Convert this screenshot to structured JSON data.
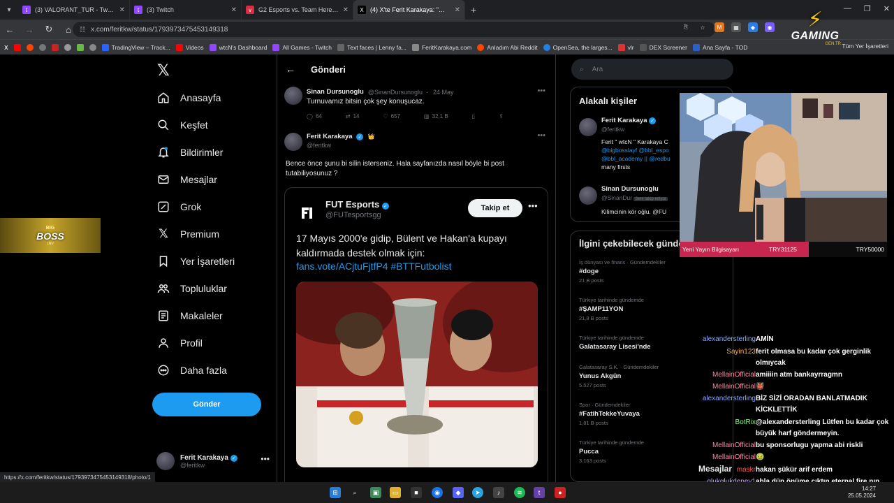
{
  "tabs": [
    {
      "label": "(3) VALORANT_TUR - Twitch",
      "color": "#9146ff"
    },
    {
      "label": "(3) Twitch",
      "color": "#9146ff"
    },
    {
      "label": "G2 Esports vs. Team Heretics | (",
      "color": "#d62d42"
    },
    {
      "label": "(4) X'te Ferit Karakaya: \"@Sinan",
      "color": "#444"
    }
  ],
  "url": "x.com/feritkw/status/1793973475453149318",
  "bookmarks": [
    {
      "label": "TradingView – Track...",
      "color": "#2962ff"
    },
    {
      "label": "Videos",
      "color": "#f00"
    },
    {
      "label": "wtcN's Dashboard",
      "color": "#9146ff"
    },
    {
      "label": "All Games - Twitch",
      "color": "#9146ff"
    },
    {
      "label": "Text faces | Lenny fa...",
      "color": "#666"
    },
    {
      "label": "FeritKarakaya.com",
      "color": "#888"
    },
    {
      "label": "Anladım Abi Reddit",
      "color": "#ff4500"
    },
    {
      "label": "OpenSea, the larges...",
      "color": "#2081e2"
    },
    {
      "label": "vlr",
      "color": "#d33"
    },
    {
      "label": "DEX Screener",
      "color": "#555"
    },
    {
      "label": "Ana Sayfa - TOD",
      "color": "#2a60c8"
    }
  ],
  "bookmarks_right": "Tüm Yer İşaretleri",
  "logo": {
    "brand": "GAMING",
    "sub": "GEN.TR"
  },
  "bigboss": {
    "line1": "BIG",
    "line2": "BOSS",
    "line3": "LNV"
  },
  "nav": [
    {
      "label": "Anasayfa",
      "icon": "home-icon"
    },
    {
      "label": "Keşfet",
      "icon": "search-icon"
    },
    {
      "label": "Bildirimler",
      "icon": "bell-icon"
    },
    {
      "label": "Mesajlar",
      "icon": "envelope-icon"
    },
    {
      "label": "Grok",
      "icon": "grok-icon"
    },
    {
      "label": "Premium",
      "icon": "x-icon"
    },
    {
      "label": "Yer İşaretleri",
      "icon": "bookmark-icon"
    },
    {
      "label": "Topluluklar",
      "icon": "people-icon"
    },
    {
      "label": "Makaleler",
      "icon": "article-icon"
    },
    {
      "label": "Profil",
      "icon": "person-icon"
    },
    {
      "label": "Daha fazla",
      "icon": "more-circle-icon"
    }
  ],
  "nav_post_button": "Gönder",
  "account": {
    "name": "Ferit Karakaya",
    "handle": "@feritkw"
  },
  "main": {
    "header": "Gönderi",
    "reply": {
      "name": "Sinan Dursunoglu",
      "handle": "@SinanDursunoglu",
      "date": "24 May",
      "text": "Turnuvamız bitsin çok şey konuşucaz.",
      "replies": "64",
      "retweets": "14",
      "likes": "657",
      "views": "32,1 B"
    },
    "post": {
      "name": "Ferit Karakaya",
      "handle": "@feritkw",
      "text": "Bence önce şunu bi silin isterseniz. Hala sayfanızda nasıl böyle bi post tutabiliyosunuz ?"
    },
    "quote": {
      "name": "FUT Esports",
      "handle": "@FUTesportsgg",
      "follow": "Takip et",
      "text": "17 Mayıs 2000'e gidip, Bülent ve Hakan'a kupayı kaldırmada destek olmak için:",
      "link": "fans.vote/ACjtuFjtfP4 #BTTFutbolist"
    }
  },
  "search_placeholder": "Ara",
  "related": {
    "title": "Alakalı kişiler",
    "people": [
      {
        "name": "Ferit Karakaya",
        "handle": "@feritkw"
      },
      {
        "name": "Sinan Dursunoglu",
        "handle": "@SinanDur",
        "badge": "Seni takip ediyor"
      }
    ],
    "bio1": [
      "Ferit \" wtcN \" Karakaya C",
      "@bigbosslayf @bbl_espo",
      "@bbl_academy || @redbu",
      "many firsts"
    ],
    "bio2": "Kilimcinin kör oğlu. @FU"
  },
  "trends": {
    "title": "İlgini çekebilecek gündem",
    "items": [
      {
        "ctx": "İş dünyası ve finans · Gündemdekiler",
        "name": "#doge",
        "count": "21 B posts"
      },
      {
        "ctx": "Türkiye tarihinde gündemde",
        "name": "#ŞAMP11YON",
        "count": "21,8 B posts"
      },
      {
        "ctx": "Türkiye tarihinde gündemde",
        "name": "Galatasaray Lisesi'nde",
        "count": ""
      },
      {
        "ctx": "Galatasaray S.K. · Gündemdekiler",
        "name": "Yunus Akgün",
        "count": "5.527 posts"
      },
      {
        "ctx": "Spor · Gündemdekiler",
        "name": "#FatihTekkeYuvaya",
        "count": "1,81 B posts"
      },
      {
        "ctx": "Türkiye tarihinde gündemde",
        "name": "Pucca",
        "count": "3.163 posts"
      }
    ]
  },
  "donation": {
    "label": "Yeni Yayın Bilgisayarı",
    "current": "TRY31125",
    "goal": "TRY50000",
    "progress": 0.6225
  },
  "chat": [
    {
      "user": "alexandersterling",
      "color": "#8aa8ff",
      "msg": "AMİN"
    },
    {
      "user": "Sayin123",
      "color": "#ffb24d",
      "msg": "ferit olmasa bu kadar çok gerginlik olmıycak"
    },
    {
      "user": "MellainOfficial",
      "color": "#ff8aa6",
      "msg": "amiiiin atm bankayrragmn"
    },
    {
      "user": "MellainOfficial",
      "color": "#ff8aa6",
      "msg": "👹"
    },
    {
      "user": "alexandersterling",
      "color": "#8aa8ff",
      "msg": "BİZ SİZİ ORADAN BANLATMADIK KİCKLETTİK"
    },
    {
      "user": "BotRix",
      "color": "#7dff7d",
      "msg": "@alexandersterling Lütfen bu kadar çok büyük harf göndermeyin."
    },
    {
      "user": "MellainOfficial",
      "color": "#ff8aa6",
      "msg": "bu sponsorlugu yapma abi riskli"
    },
    {
      "user": "MellainOfficial",
      "color": "#ff8aa6",
      "msg": "🤢"
    },
    {
      "user": "maskr",
      "color": "#ff5a5a",
      "msg": "hakan şükür arif erdem"
    },
    {
      "user": "glukglukdeney1",
      "color": "#c9a7ff",
      "msg": "abla dün önüme çıktın eternal fire nın instasında paylaşmışsın"
    }
  ],
  "messages_label": "Mesajlar",
  "status_url": "https://x.com/feritkw/status/1793973475453149318/photo/1",
  "clock": {
    "time": "14:27",
    "date": "25.05.2024"
  }
}
